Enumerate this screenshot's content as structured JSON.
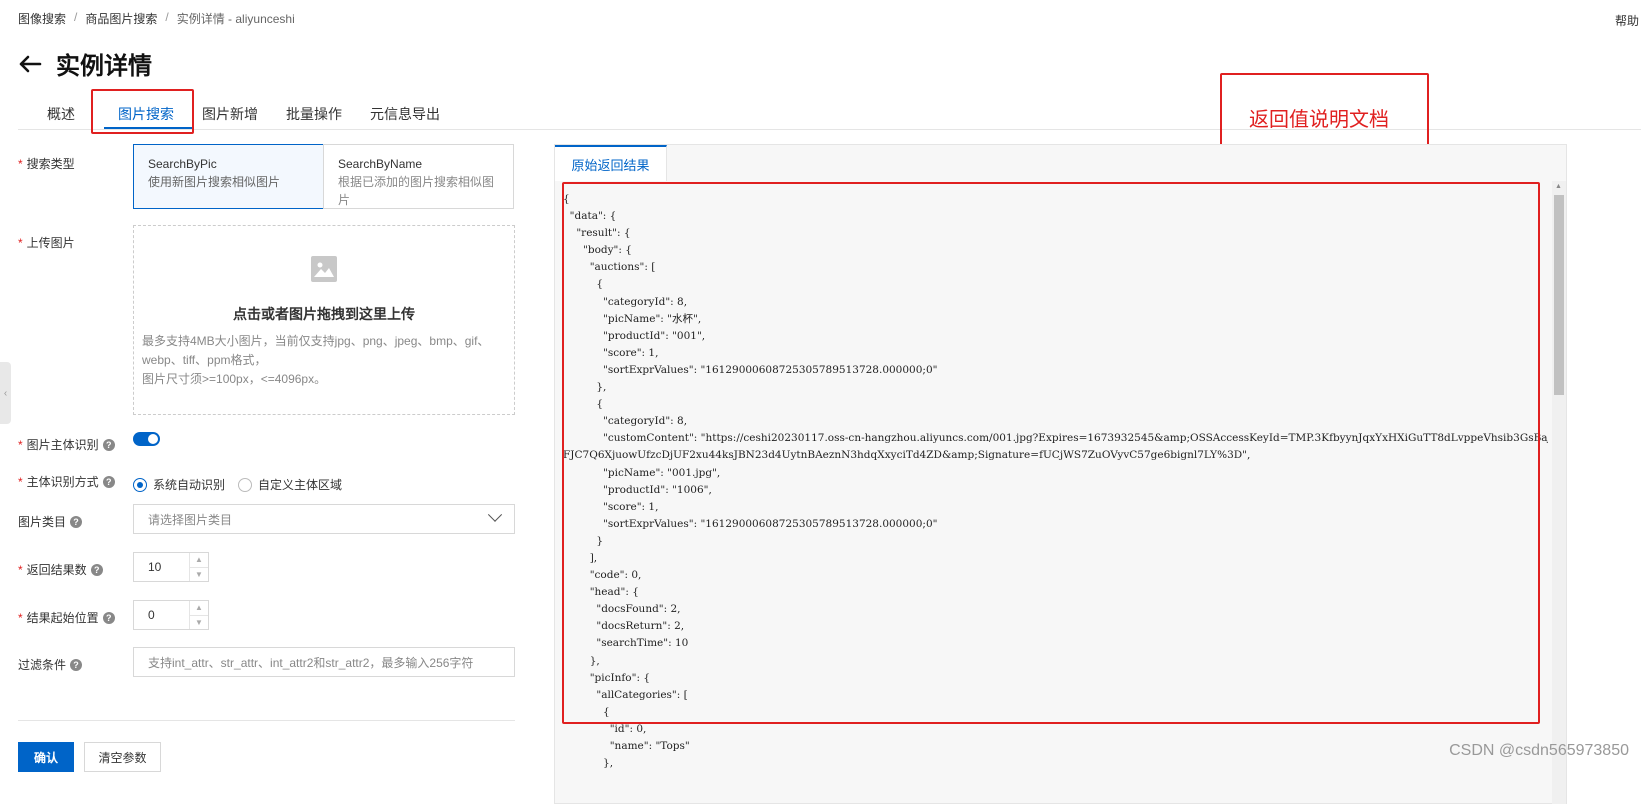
{
  "breadcrumb": {
    "item1": "图像搜索",
    "item2": "商品图片搜索",
    "item3": "实例详情 - aliyunceshi",
    "sep": "/"
  },
  "help_link": "帮助",
  "title": "实例详情",
  "tabs": [
    "概述",
    "图片搜索",
    "图片新增",
    "批量操作",
    "元信息导出"
  ],
  "annotation": "返回值说明文档",
  "form": {
    "search_type_label": "搜索类型",
    "search_type_options": [
      {
        "title": "SearchByPic",
        "desc": "使用新图片搜索相似图片"
      },
      {
        "title": "SearchByName",
        "desc": "根据已添加的图片搜索相似图片"
      }
    ],
    "upload_label": "上传图片",
    "upload_title": "点击或者图片拖拽到这里上传",
    "upload_desc_1": "最多支持4MB大小图片，当前仅支持jpg、png、jpeg、bmp、gif、",
    "upload_desc_2": "webp、tiff、ppm格式，",
    "upload_desc_3": "图片尺寸须>=100px，<=4096px。",
    "subject_label": "图片主体识别",
    "subject_method_label": "主体识别方式",
    "subject_methods": [
      "系统自动识别",
      "自定义主体区域"
    ],
    "category_label": "图片类目",
    "category_placeholder": "请选择图片类目",
    "result_count_label": "返回结果数",
    "result_count_value": "10",
    "start_label": "结果起始位置",
    "start_value": "0",
    "filter_label": "过滤条件",
    "filter_placeholder": "支持int_attr、str_attr、int_attr2和str_attr2，最多输入256字符",
    "confirm": "确认",
    "clear": "清空参数"
  },
  "result": {
    "tab": "原始返回结果",
    "json_text": "{\n  \"data\": {\n    \"result\": {\n      \"body\": {\n        \"auctions\": [\n          {\n            \"categoryId\": 8,\n            \"picName\": \"水杯\",\n            \"productId\": \"001\",\n            \"score\": 1,\n            \"sortExprValues\": \"1612900060872530578951372​8.000000;0\"\n          },\n          {\n            \"categoryId\": 8,\n            \"customContent\": \"https://ceshi20230117.oss-cn-hangzhou.aliyuncs.com/001.jpg?Expires=1673932545&amp;OSSAccessKeyId=TMP.3KfbyynJqxYxHXiGuTT8dLvppeVhsib3GsBaJ\nFJC7Q6XjuowUfzcDjUF2xu44ksJBN23d4UytnBAeznN3hdqXxyciTd4ZD&amp;Signature=fUCjWS7ZuOVyvC57ge6bignl7LY%3D\",\n            \"picName\": \"001.jpg\",\n            \"productId\": \"1006\",\n            \"score\": 1,\n            \"sortExprValues\": \"1612900060872530578951372​8.000000;0\"\n          }\n        ],\n        \"code\": 0,\n        \"head\": {\n          \"docsFound\": 2,\n          \"docsReturn\": 2,\n          \"searchTime\": 10\n        },\n        \"picInfo\": {\n          \"allCategories\": [\n            {\n              \"id\": 0,\n              \"name\": \"Tops\"\n            },"
  },
  "watermark": "CSDN @csdn565973850",
  "colors": {
    "accent": "#0064c8",
    "annotation_red": "#e02020"
  }
}
